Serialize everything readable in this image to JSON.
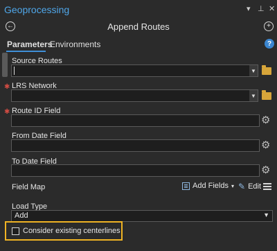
{
  "window": {
    "title": "Geoprocessing",
    "controls": [
      "▾",
      "⊥",
      "✕"
    ]
  },
  "tool": {
    "back_glyph": "←",
    "title": "Append Routes",
    "add_glyph": "+"
  },
  "tabs": [
    {
      "label": "Parameters",
      "active": true
    },
    {
      "label": "Environments",
      "active": false
    }
  ],
  "help_glyph": "?",
  "params": {
    "source_routes": {
      "label": "Source Routes",
      "value": ""
    },
    "lrs_network": {
      "label": "LRS Network",
      "value": "",
      "required": true
    },
    "route_id_field": {
      "label": "Route ID Field",
      "value": "",
      "required": true
    },
    "from_date_field": {
      "label": "From Date Field",
      "value": ""
    },
    "to_date_field": {
      "label": "To Date Field",
      "value": ""
    },
    "field_map": {
      "label": "Field Map",
      "add_fields_label": "Add Fields",
      "add_fields_chevron": "▾",
      "edit_label": "Edit"
    },
    "load_type": {
      "label": "Load Type",
      "value": "Add"
    },
    "consider_existing": {
      "label": "Consider existing centerlines",
      "checked": false
    }
  },
  "colors": {
    "accent": "#4fa6e8",
    "highlight": "#f0b323",
    "required": "#d24c43",
    "folder": "#d7a53a"
  },
  "icons": {
    "required_marker": "✱",
    "dropdown": "▼",
    "gear": "⚙",
    "pencil": "✎"
  }
}
